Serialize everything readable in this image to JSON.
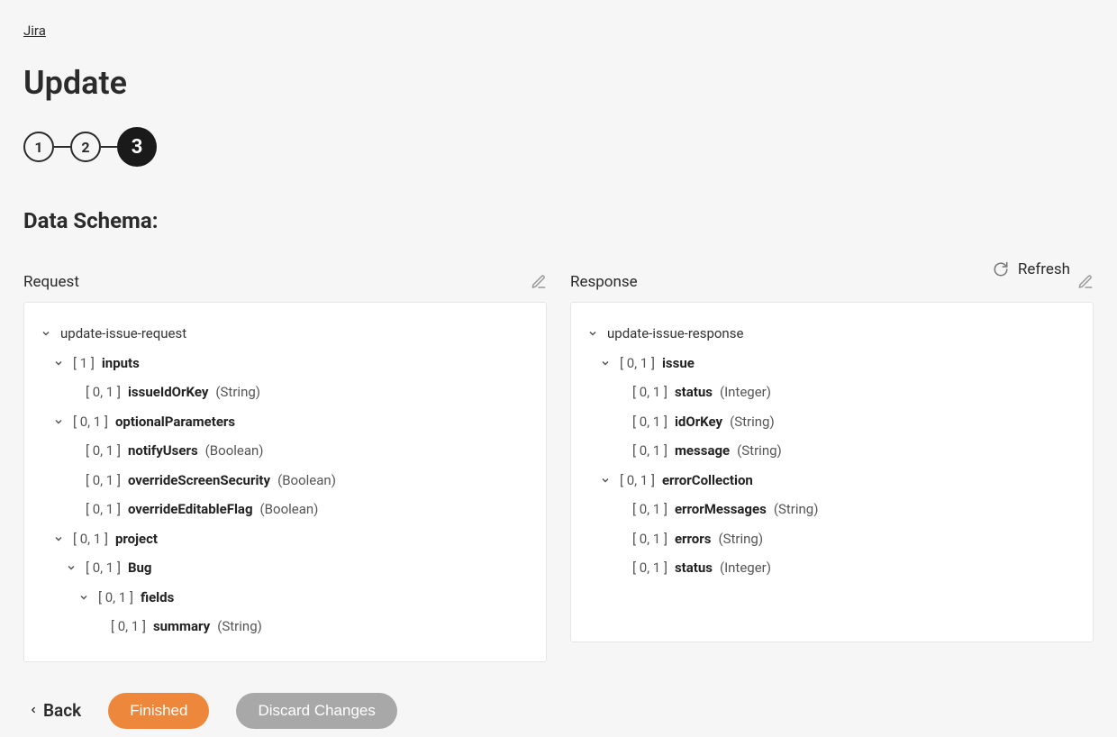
{
  "breadcrumb": "Jira",
  "title": "Update",
  "stepper": {
    "s1": "1",
    "s2": "2",
    "s3": "3"
  },
  "section_title": "Data Schema:",
  "refresh_label": "Refresh",
  "request": {
    "header": "Request",
    "root": "update-issue-request",
    "inputs": {
      "card": "[ 1 ]",
      "name": "inputs"
    },
    "issueIdOrKey": {
      "card": "[ 0, 1 ]",
      "name": "issueIdOrKey",
      "type": "(String)"
    },
    "optionalParameters": {
      "card": "[ 0, 1 ]",
      "name": "optionalParameters"
    },
    "notifyUsers": {
      "card": "[ 0, 1 ]",
      "name": "notifyUsers",
      "type": "(Boolean)"
    },
    "overrideScreenSecurity": {
      "card": "[ 0, 1 ]",
      "name": "overrideScreenSecurity",
      "type": "(Boolean)"
    },
    "overrideEditableFlag": {
      "card": "[ 0, 1 ]",
      "name": "overrideEditableFlag",
      "type": "(Boolean)"
    },
    "project": {
      "card": "[ 0, 1 ]",
      "name": "project"
    },
    "bug": {
      "card": "[ 0, 1 ]",
      "name": "Bug"
    },
    "fields": {
      "card": "[ 0, 1 ]",
      "name": "fields"
    },
    "summary": {
      "card": "[ 0, 1 ]",
      "name": "summary",
      "type": "(String)"
    }
  },
  "response": {
    "header": "Response",
    "root": "update-issue-response",
    "issue": {
      "card": "[ 0, 1 ]",
      "name": "issue"
    },
    "status": {
      "card": "[ 0, 1 ]",
      "name": "status",
      "type": "(Integer)"
    },
    "idOrKey": {
      "card": "[ 0, 1 ]",
      "name": "idOrKey",
      "type": "(String)"
    },
    "message": {
      "card": "[ 0, 1 ]",
      "name": "message",
      "type": "(String)"
    },
    "errorCollection": {
      "card": "[ 0, 1 ]",
      "name": "errorCollection"
    },
    "errorMessages": {
      "card": "[ 0, 1 ]",
      "name": "errorMessages",
      "type": "(String)"
    },
    "errors": {
      "card": "[ 0, 1 ]",
      "name": "errors",
      "type": "(String)"
    },
    "status2": {
      "card": "[ 0, 1 ]",
      "name": "status",
      "type": "(Integer)"
    }
  },
  "footer": {
    "back": "Back",
    "finished": "Finished",
    "discard": "Discard Changes"
  }
}
